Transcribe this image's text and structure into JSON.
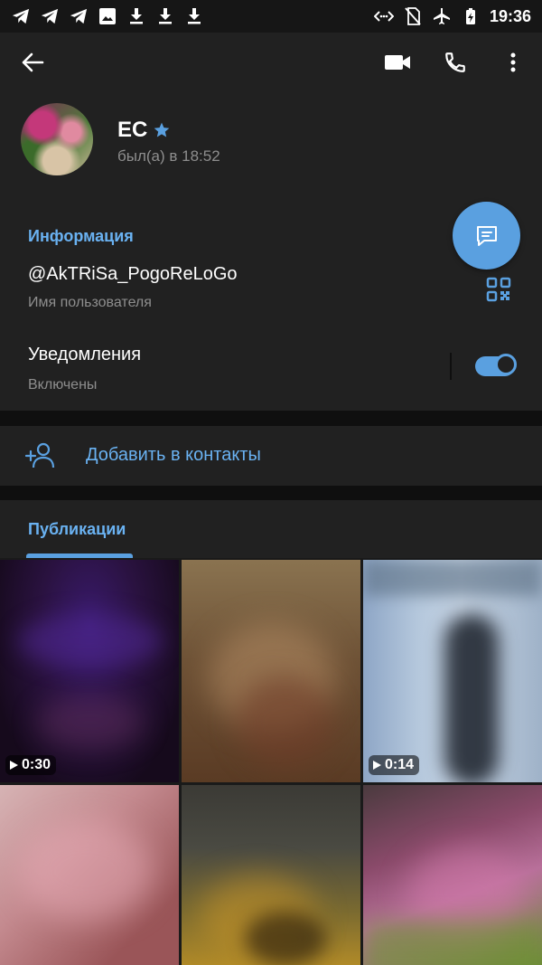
{
  "statusbar": {
    "time": "19:36",
    "left_icons": [
      "telegram-icon",
      "telegram-icon",
      "telegram-icon",
      "image-icon",
      "download-icon",
      "download-icon",
      "download-icon"
    ],
    "right_icons": [
      "data-saver-icon",
      "no-sim-icon",
      "airplane-icon",
      "battery-charging-icon"
    ]
  },
  "profile": {
    "name": "ЕС",
    "status": "был(а) в 18:52",
    "badge_icon": "star-icon"
  },
  "info": {
    "section_title": "Информация",
    "username": "@AkTRiSa_PogoReLoGo",
    "username_label": "Имя пользователя",
    "notifications_title": "Уведомления",
    "notifications_value": "Включены",
    "notifications_enabled": true
  },
  "actions": {
    "add_contact": "Добавить в контакты"
  },
  "media": {
    "tab_label": "Публикации",
    "items": [
      {
        "type": "video",
        "duration": "0:30"
      },
      {
        "type": "photo",
        "duration": ""
      },
      {
        "type": "video",
        "duration": "0:14"
      },
      {
        "type": "photo",
        "duration": ""
      },
      {
        "type": "photo",
        "duration": ""
      },
      {
        "type": "photo",
        "duration": ""
      }
    ]
  },
  "colors": {
    "accent": "#5aa0e0",
    "accent_text": "#6ab2f2",
    "background": "#212121",
    "separator": "#0f0f0f"
  }
}
